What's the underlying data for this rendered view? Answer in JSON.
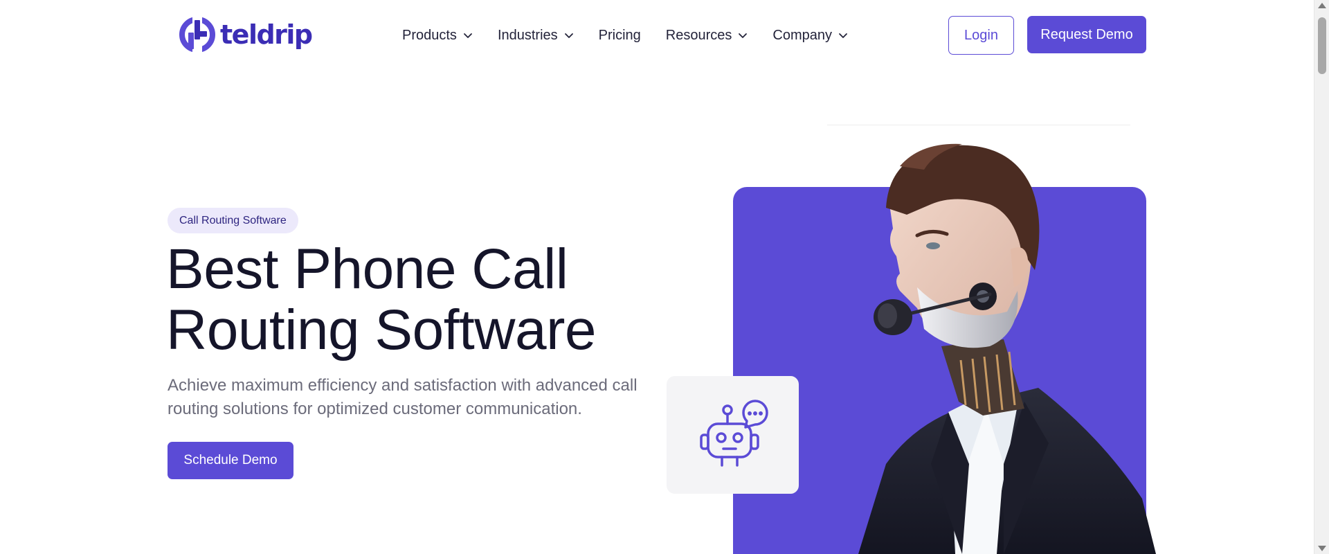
{
  "brand": {
    "name": "teldrip",
    "accent": "#5b4bd6"
  },
  "nav": {
    "items": [
      {
        "label": "Products",
        "has_dropdown": true
      },
      {
        "label": "Industries",
        "has_dropdown": true
      },
      {
        "label": "Pricing",
        "has_dropdown": false
      },
      {
        "label": "Resources",
        "has_dropdown": true
      },
      {
        "label": "Company",
        "has_dropdown": true
      }
    ]
  },
  "actions": {
    "login_label": "Login",
    "request_demo_label": "Request Demo"
  },
  "hero": {
    "badge": "Call Routing Software",
    "title_line1": "Best Phone Call",
    "title_line2": "Routing Software",
    "subtitle": "Achieve maximum efficiency and satisfaction with advanced call routing solutions for optimized customer communication.",
    "cta_label": "Schedule Demo"
  },
  "icons": {
    "logo": "teldrip-logo-icon",
    "dropdown": "chevron-down-icon",
    "chatbot": "chatbot-icon"
  },
  "colors": {
    "accent": "#5b4bd6",
    "badge_bg": "#ece9fb",
    "text_dark": "#15152a",
    "text_muted": "#6b6b7a",
    "card_bg": "#f4f4f6"
  }
}
